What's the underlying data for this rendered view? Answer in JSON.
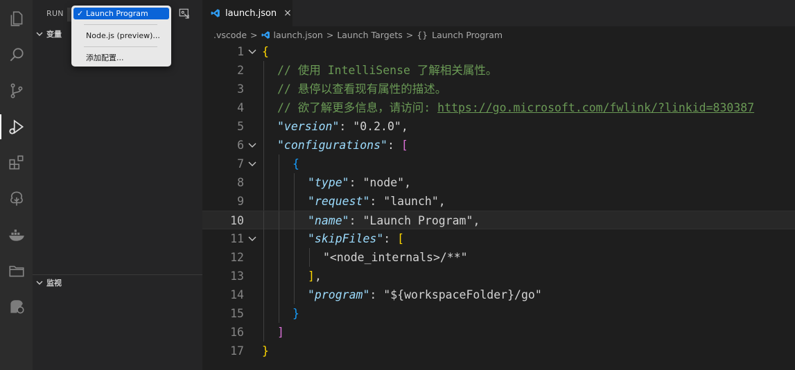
{
  "activity_bar": {
    "items": [
      {
        "name": "explorer-icon"
      },
      {
        "name": "search-icon"
      },
      {
        "name": "source-control-icon"
      },
      {
        "name": "run-debug-icon",
        "active": true
      },
      {
        "name": "extensions-icon"
      },
      {
        "name": "tree-icon"
      },
      {
        "name": "docker-icon"
      },
      {
        "name": "folder-icon"
      },
      {
        "name": "remote-explorer-icon"
      }
    ]
  },
  "sidebar": {
    "run_label": "RUN",
    "variables_label": "变量",
    "watch_label": "监视"
  },
  "config_dropdown": {
    "items": [
      {
        "label": "Launch Program",
        "checked": true
      },
      {
        "label": "Node.js (preview)..."
      },
      {
        "label": "添加配置..."
      }
    ]
  },
  "editor": {
    "tab": {
      "label": "launch.json",
      "close": "×"
    },
    "breadcrumb": [
      ".vscode",
      "launch.json",
      "Launch Targets",
      "Launch Program"
    ],
    "breadcrumb_sep": ">",
    "current_line": 10,
    "lines": [
      {
        "n": "1",
        "fold": true,
        "indent": 0,
        "segs": [
          [
            "b1",
            "{"
          ]
        ]
      },
      {
        "n": "2",
        "indent": 1,
        "segs": [
          [
            "c",
            "// 使用 IntelliSense 了解相关属性。"
          ]
        ]
      },
      {
        "n": "3",
        "indent": 1,
        "segs": [
          [
            "c",
            "// 悬停以查看现有属性的描述。"
          ]
        ]
      },
      {
        "n": "4",
        "indent": 1,
        "segs": [
          [
            "c",
            "// 欲了解更多信息，请访问: "
          ],
          [
            "u",
            "https://go.microsoft.com/fwlink/?linkid=830387"
          ]
        ]
      },
      {
        "n": "5",
        "indent": 1,
        "segs": [
          [
            "k",
            "\"version\""
          ],
          [
            "p",
            ": "
          ],
          [
            "s2",
            "\"0.2.0\""
          ],
          [
            "p",
            ","
          ]
        ]
      },
      {
        "n": "6",
        "fold": true,
        "indent": 1,
        "segs": [
          [
            "k",
            "\"configurations\""
          ],
          [
            "p",
            ": "
          ],
          [
            "b2",
            "["
          ]
        ]
      },
      {
        "n": "7",
        "fold": true,
        "indent": 2,
        "segs": [
          [
            "b3",
            "{"
          ]
        ]
      },
      {
        "n": "8",
        "indent": 3,
        "segs": [
          [
            "k",
            "\"type\""
          ],
          [
            "p",
            ": "
          ],
          [
            "s2",
            "\"node\""
          ],
          [
            "p",
            ","
          ]
        ]
      },
      {
        "n": "9",
        "indent": 3,
        "segs": [
          [
            "k",
            "\"request\""
          ],
          [
            "p",
            ": "
          ],
          [
            "s2",
            "\"launch\""
          ],
          [
            "p",
            ","
          ]
        ]
      },
      {
        "n": "10",
        "indent": 3,
        "segs": [
          [
            "k",
            "\"name\""
          ],
          [
            "p",
            ": "
          ],
          [
            "s2",
            "\"Launch Program\""
          ],
          [
            "p",
            ","
          ]
        ]
      },
      {
        "n": "11",
        "fold": true,
        "indent": 3,
        "segs": [
          [
            "k",
            "\"skipFiles\""
          ],
          [
            "p",
            ": "
          ],
          [
            "b1",
            "["
          ]
        ]
      },
      {
        "n": "12",
        "indent": 4,
        "segs": [
          [
            "s2",
            "\"<node_internals>/**\""
          ]
        ]
      },
      {
        "n": "13",
        "indent": 3,
        "segs": [
          [
            "b1",
            "]"
          ],
          [
            "p",
            ","
          ]
        ]
      },
      {
        "n": "14",
        "indent": 3,
        "segs": [
          [
            "k",
            "\"program\""
          ],
          [
            "p",
            ": "
          ],
          [
            "s2",
            "\"${workspaceFolder}/go\""
          ]
        ]
      },
      {
        "n": "15",
        "indent": 2,
        "segs": [
          [
            "b3",
            "}"
          ]
        ]
      },
      {
        "n": "16",
        "indent": 1,
        "segs": [
          [
            "b2",
            "]"
          ]
        ]
      },
      {
        "n": "17",
        "indent": 0,
        "segs": [
          [
            "b1",
            "}"
          ]
        ]
      }
    ]
  }
}
